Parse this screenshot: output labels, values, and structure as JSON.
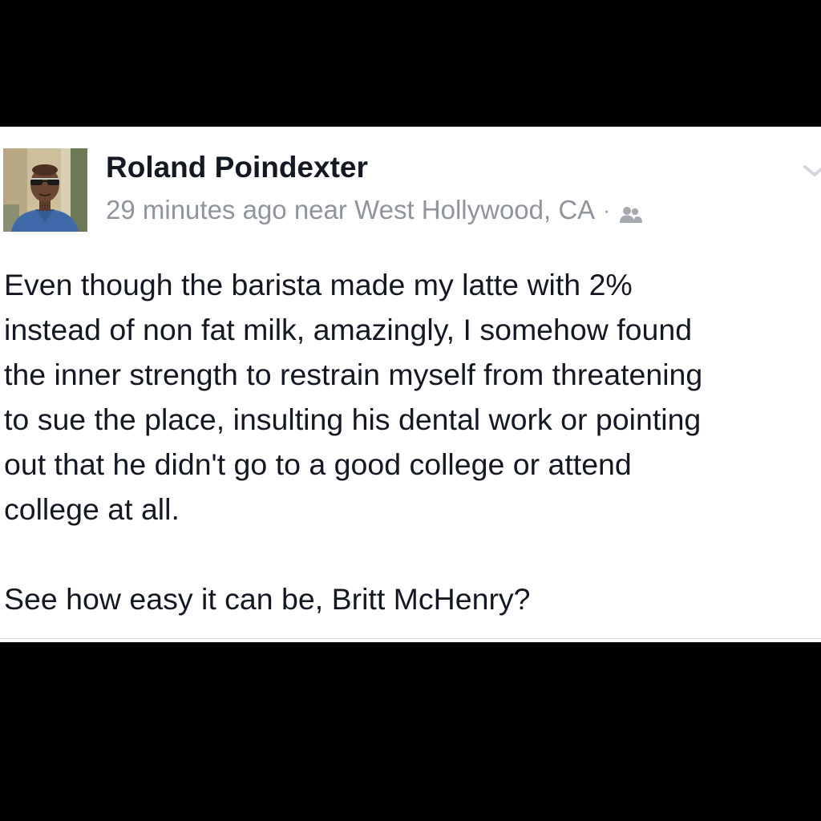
{
  "post": {
    "author_name": "Roland Poindexter",
    "meta_text": "29 minutes ago near West Hollywood, CA",
    "separator": "·",
    "audience_icon": "friends-icon",
    "menu_icon": "chevron-down-icon",
    "body_paragraph_1": [
      "Even though the barista made my latte with 2%",
      "instead of non fat milk, amazingly, I somehow found",
      "the inner strength to restrain myself from threatening",
      "to sue the place, insulting his dental work or pointing",
      "out that he didn't go to a good college or attend",
      "college at all."
    ],
    "body_paragraph_2": "See how easy it can be, Britt McHenry?"
  },
  "colors": {
    "background": "#000000",
    "card": "#ffffff",
    "text_primary": "#141823",
    "text_secondary": "#90949c"
  }
}
